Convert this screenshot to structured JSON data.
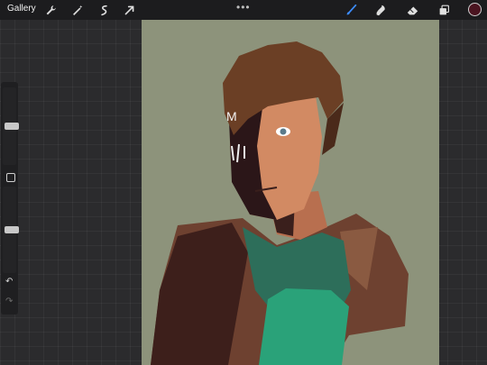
{
  "toolbar": {
    "gallery_label": "Gallery",
    "more_label": "•••",
    "left_tools": [
      "wrench-icon",
      "magic-wand-icon",
      "selection-icon",
      "transform-arrow-icon"
    ],
    "right_tools": [
      "brush-icon",
      "smudge-icon",
      "eraser-icon",
      "layers-icon"
    ],
    "active_tool": "brush-icon",
    "active_color": "#4a1420"
  },
  "sidebar": {
    "brush_size_level": 0.5,
    "opacity_level": 0.5,
    "undo_label": "↶",
    "redo_label": "↷"
  },
  "canvas": {
    "background_color": "#8d937b",
    "drawn_text": "M"
  },
  "colors": {
    "accent_blue": "#3c8cff",
    "hair": "#6b3f25",
    "skin": "#d28a63",
    "jacket": "#6e4130",
    "shirt": "#2aa279"
  }
}
